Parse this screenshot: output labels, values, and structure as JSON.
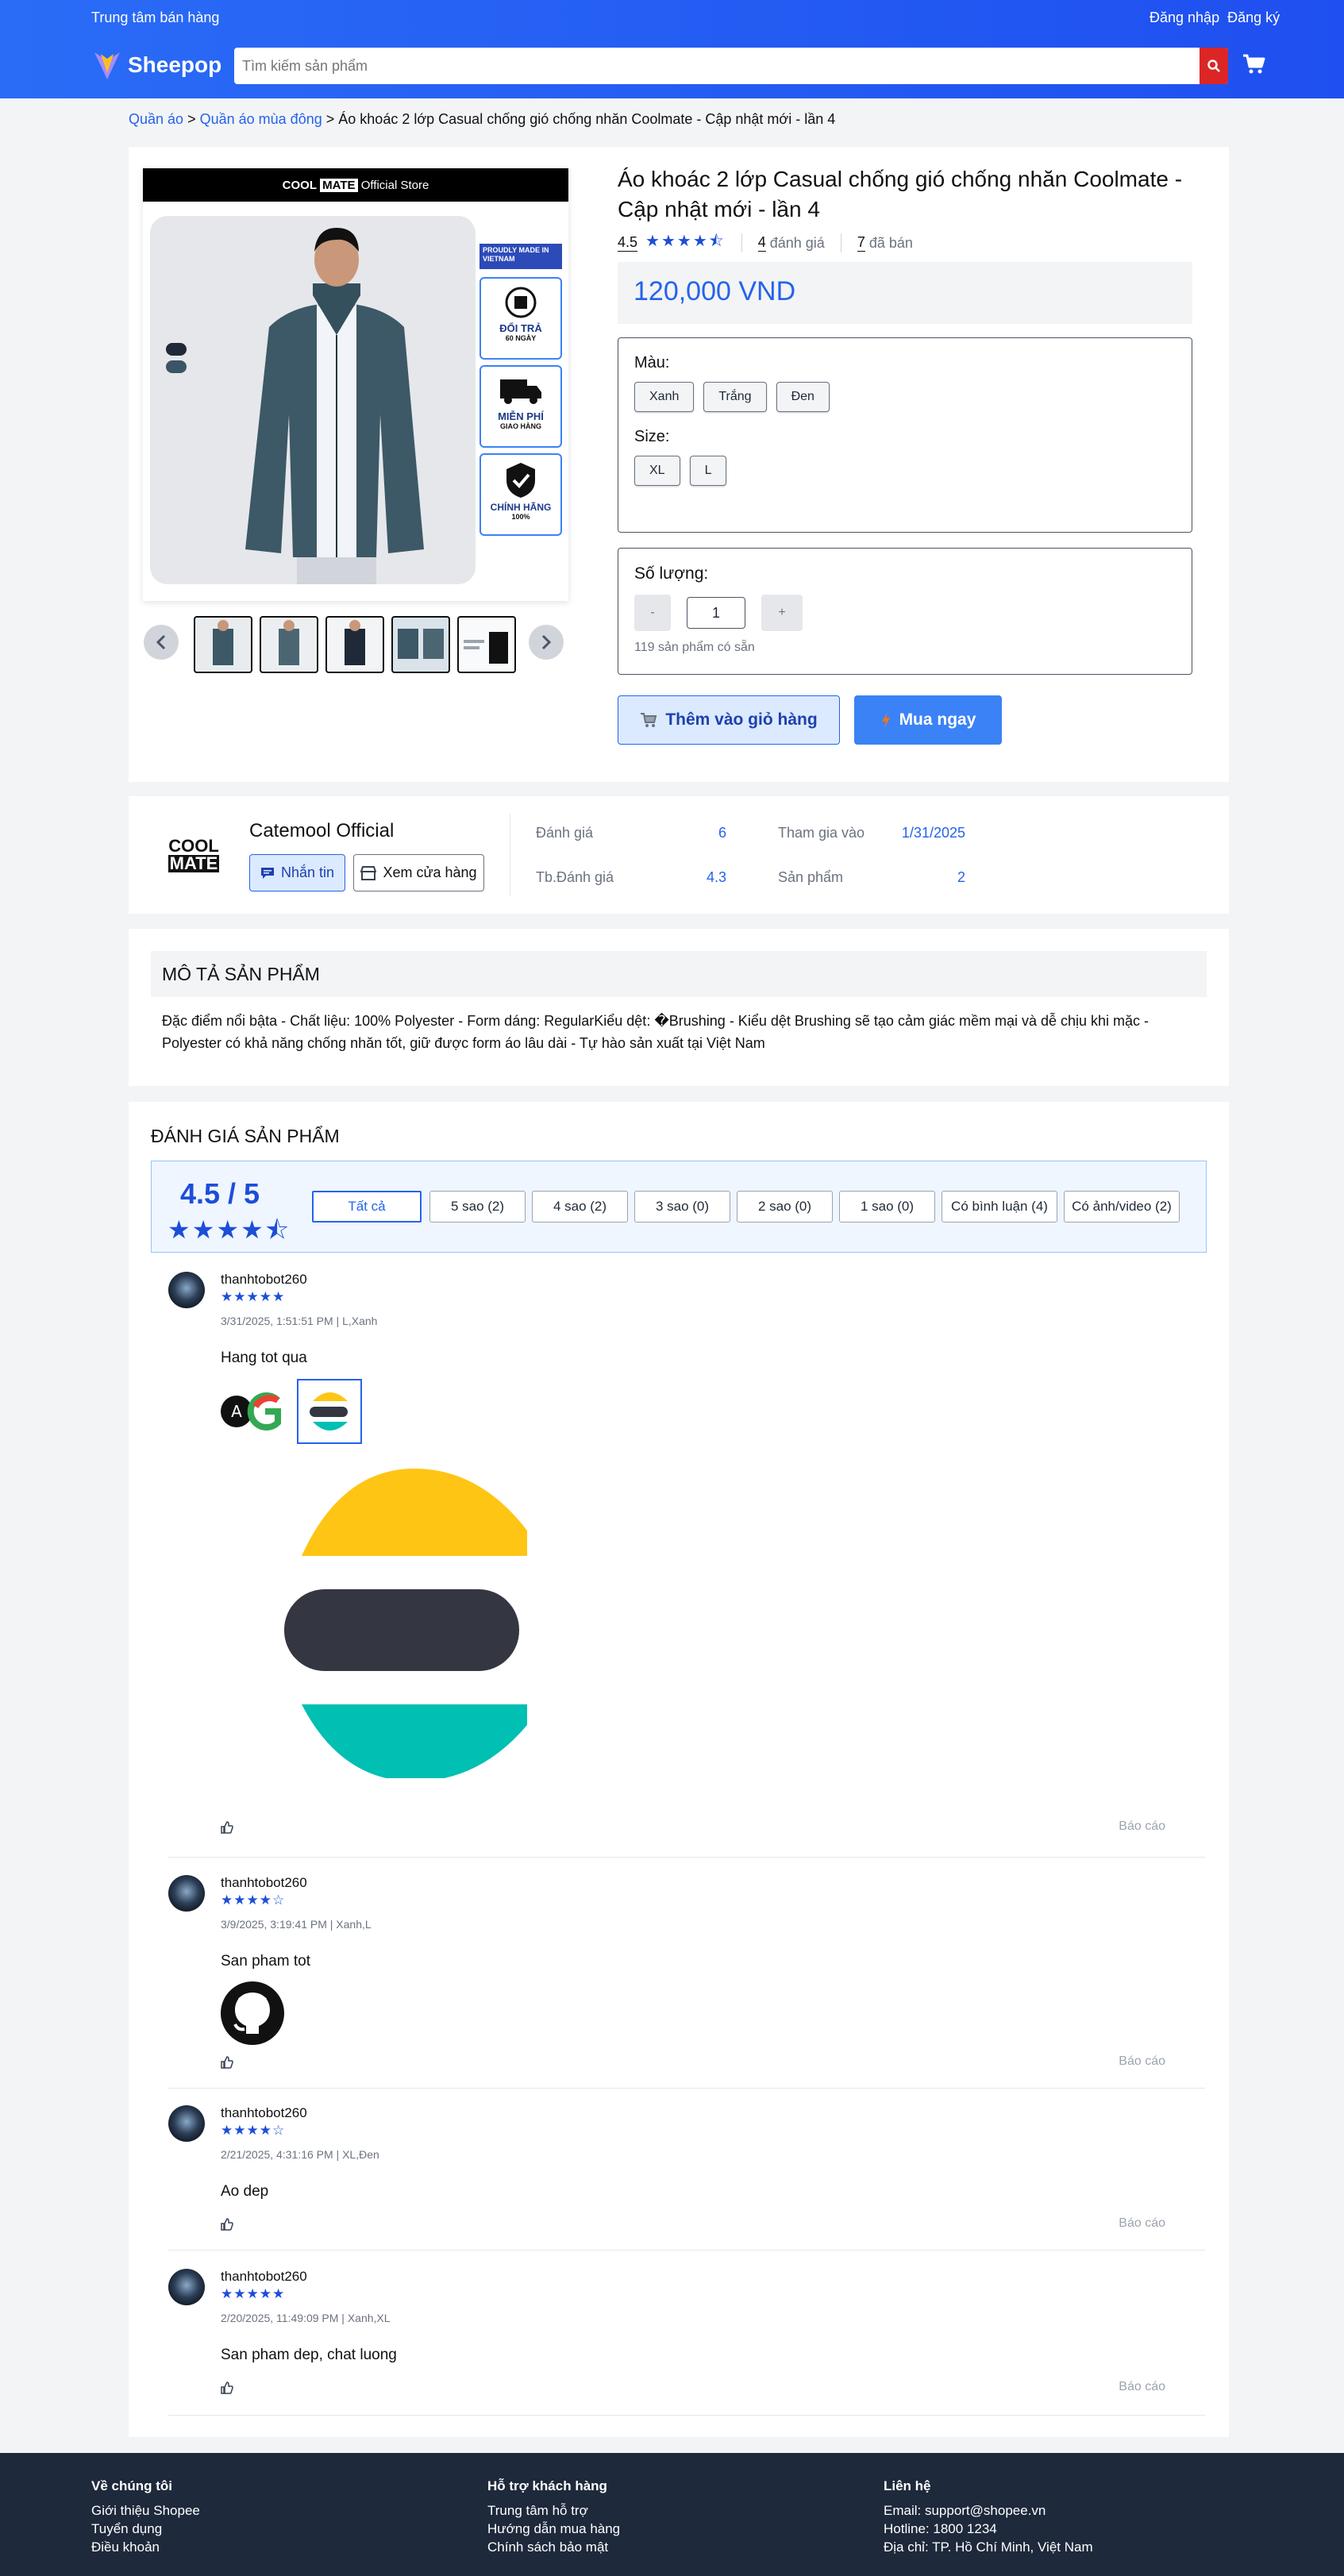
{
  "header": {
    "seller_center": "Trung tâm bán hàng",
    "login": "Đăng nhập",
    "register": "Đăng ký",
    "brand": "Sheepop",
    "search_placeholder": "Tìm kiếm sản phẩm",
    "accent": "#2563eb"
  },
  "breadcrumb": {
    "items": [
      "Quần áo",
      "Quần áo mùa đông"
    ],
    "separator": ">",
    "current": "Áo khoác 2 lớp Casual chống gió chống nhăn Coolmate - Cập nhật mới - lần 4"
  },
  "product": {
    "store_banner": {
      "brand_a": "COOL",
      "brand_b": "MATE",
      "label": "Official Store"
    },
    "badges": [
      {
        "title": "PROUDLY MADE IN VIETNAM",
        "sub": ""
      },
      {
        "title": "ĐỔI TRẢ",
        "sub": "60 NGÀY"
      },
      {
        "title": "MIỄN PHÍ",
        "sub": "GIAO HÀNG"
      },
      {
        "title": "CHÍNH HÃNG",
        "sub": "100%"
      }
    ],
    "title": "Áo khoác 2 lớp Casual chống gió chống nhăn Coolmate - Cập nhật mới - lần 4",
    "rating": "4.5",
    "rating_stars": 4.5,
    "review_count": "4",
    "review_label": "đánh giá",
    "sold_count": "7",
    "sold_label": "đã bán",
    "price": "120,000 VND",
    "color_label": "Màu:",
    "colors": [
      "Xanh",
      "Trắng",
      "Đen"
    ],
    "size_label": "Size:",
    "sizes": [
      "XL",
      "L"
    ],
    "qty_label": "Số lượng:",
    "qty_minus": "-",
    "qty_value": "1",
    "qty_plus": "+",
    "stock": "119 sản phẩm có sẵn",
    "add_cart": "Thêm vào giỏ hàng",
    "buy_now": "Mua ngay"
  },
  "shop": {
    "logo_a": "COOL",
    "logo_b": "MATE",
    "name": "Catemool Official",
    "chat": "Nhắn tin",
    "view_shop": "Xem cửa hàng",
    "stats": [
      {
        "label": "Đánh giá",
        "value": "6"
      },
      {
        "label": "Tham gia vào",
        "value": "1/31/2025"
      },
      {
        "label": "Tb.Đánh giá",
        "value": "4.3"
      },
      {
        "label": "Sản phẩm",
        "value": "2"
      }
    ]
  },
  "description": {
    "heading": "MÔ TẢ SẢN PHẨM",
    "text": "Đặc điểm nổi bậta - Chất liệu: 100% Polyester - Form dáng: RegularKiểu dệt: �Brushing - Kiểu dệt Brushing sẽ tạo cảm giác mềm mại và dễ chịu khi mặc - Polyester có khả năng chống nhăn tốt, giữ được form áo lâu dài - Tự hào sản xuất tại Việt Nam"
  },
  "reviews": {
    "heading": "ĐÁNH GIÁ SẢN PHẨM",
    "score": "4.5 / 5",
    "filters": [
      "Tất cả",
      "5 sao (2)",
      "4 sao (2)",
      "3 sao (0)",
      "2 sao (0)",
      "1 sao (0)",
      "Có bình luận (4)",
      "Có ảnh/video (2)"
    ],
    "report_label": "Báo cáo",
    "items": [
      {
        "user": "thanhtobot260",
        "stars": "★★★★★",
        "meta": "3/31/2025, 1:51:51 PM | L,Xanh",
        "text": "Hang tot qua"
      },
      {
        "user": "thanhtobot260",
        "stars": "★★★★☆",
        "meta": "3/9/2025, 3:19:41 PM | Xanh,L",
        "text": "San pham tot"
      },
      {
        "user": "thanhtobot260",
        "stars": "★★★★☆",
        "meta": "2/21/2025, 4:31:16 PM | XL,Đen",
        "text": "Ao dep"
      },
      {
        "user": "thanhtobot260",
        "stars": "★★★★★",
        "meta": "2/20/2025, 11:49:09 PM | Xanh,XL",
        "text": "San pham dep, chat luong"
      }
    ]
  },
  "footer": {
    "about_title": "Về chúng tôi",
    "about_items": [
      "Giới thiệu Shopee",
      "Tuyển dụng",
      "Điều khoản"
    ],
    "support_title": "Hỗ trợ khách hàng",
    "support_items": [
      "Trung tâm hỗ trợ",
      "Hướng dẫn mua hàng",
      "Chính sách bảo mật"
    ],
    "contact_title": "Liên hệ",
    "contact_items": [
      "Email: support@shopee.vn",
      "Hotline: 1800 1234",
      "Địa chỉ: TP. Hồ Chí Minh, Việt Nam"
    ]
  }
}
